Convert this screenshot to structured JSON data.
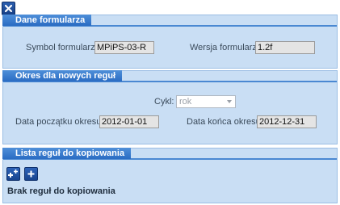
{
  "toolbar": {
    "close_icon": "close-icon"
  },
  "form_data": {
    "title": "Dane formularza",
    "symbol_label": "Symbol formularza:",
    "symbol_value": "MPiPS-03-R",
    "version_label": "Wersja formularza:",
    "version_value": "1.2f"
  },
  "period": {
    "title": "Okres dla nowych reguł",
    "cycle_label": "Cykl:",
    "cycle_value": "rok",
    "start_label": "Data początku okresu:",
    "start_value": "2012-01-01",
    "end_label": "Data końca okresu:",
    "end_value": "2012-12-31"
  },
  "rules": {
    "title": "Lista reguł do kopiowania",
    "add_many_icon": "add-multiple-icon",
    "add_icon": "add-icon",
    "empty_text": "Brak reguł do kopiowania"
  }
}
